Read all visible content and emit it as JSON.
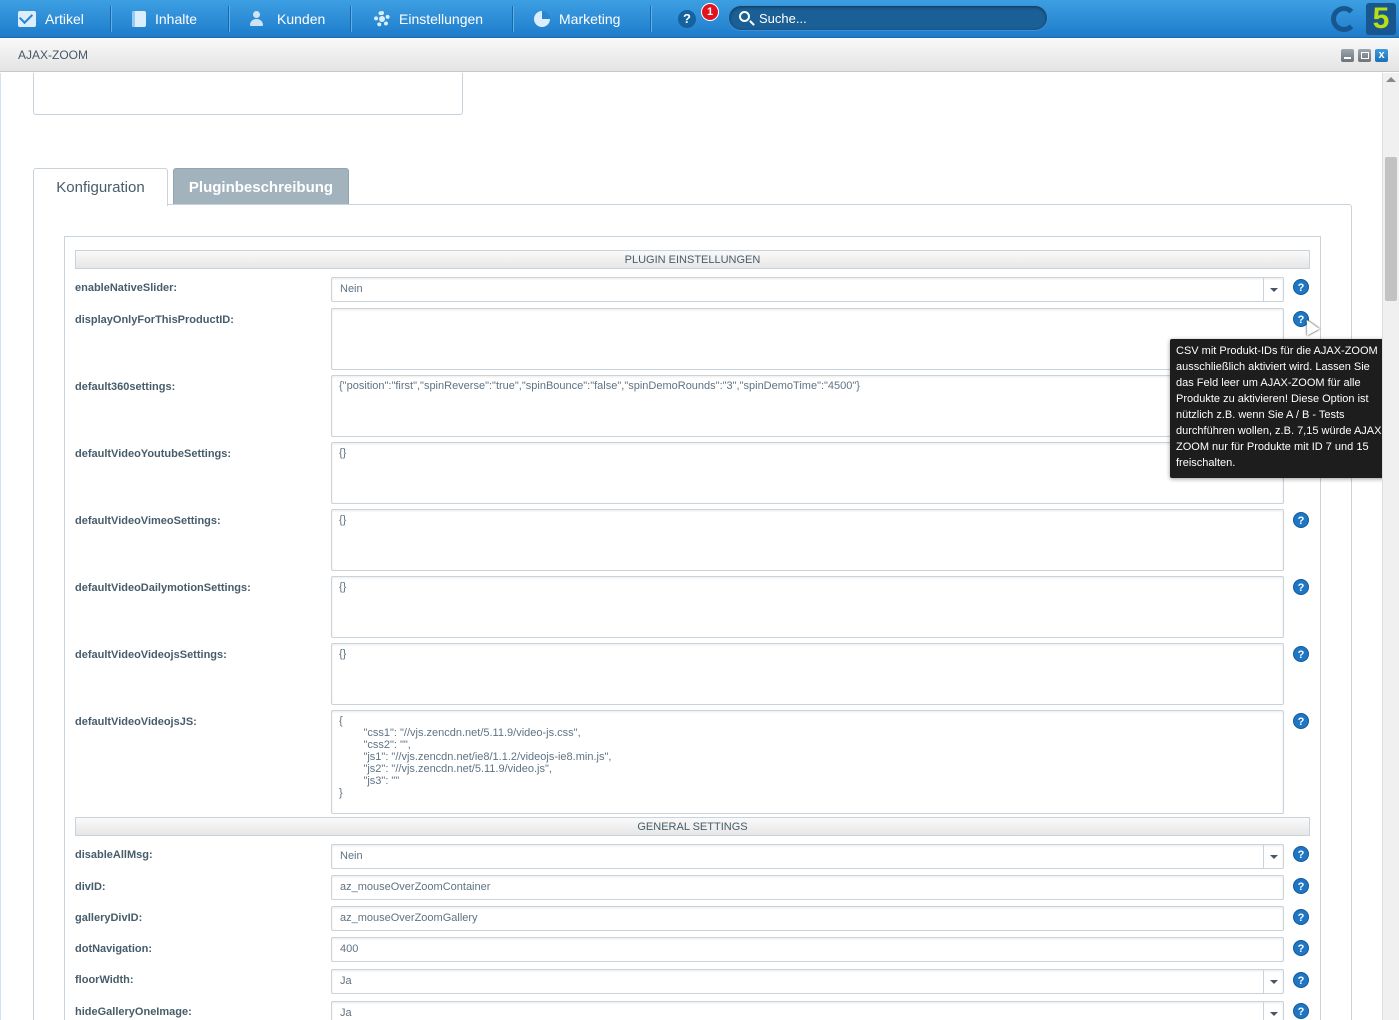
{
  "topnav": {
    "items": [
      {
        "label": "Artikel",
        "icon": "mail-icon"
      },
      {
        "label": "Inhalte",
        "icon": "book-icon"
      },
      {
        "label": "Kunden",
        "icon": "users-icon"
      },
      {
        "label": "Einstellungen",
        "icon": "gear-icon"
      },
      {
        "label": "Marketing",
        "icon": "pie-chart-icon"
      }
    ],
    "help_label": "?",
    "notification_count": "1",
    "search_placeholder": "Suche...",
    "logo_text": "5",
    "colors": {
      "bar": "#1e7ccb",
      "notification": "#e0141e",
      "logo_accent": "#b7df12"
    }
  },
  "window": {
    "title": "AJAX-ZOOM",
    "close_label": "x"
  },
  "tabs": [
    {
      "label": "Konfiguration",
      "active": true
    },
    {
      "label": "Pluginbeschreibung",
      "active": false
    }
  ],
  "sections": {
    "plugin": "PLUGIN EINSTELLUNGEN",
    "general": "GENERAL SETTINGS"
  },
  "help_icon_label": "?",
  "fields": {
    "enableNativeSlider": {
      "label": "enableNativeSlider:",
      "value": "Nein"
    },
    "displayOnlyForThisProductID": {
      "label": "displayOnlyForThisProductID:",
      "value": ""
    },
    "default360settings": {
      "label": "default360settings:",
      "value": "{\"position\":\"first\",\"spinReverse\":\"true\",\"spinBounce\":\"false\",\"spinDemoRounds\":\"3\",\"spinDemoTime\":\"4500\"}"
    },
    "defaultVideoYoutubeSettings": {
      "label": "defaultVideoYoutubeSettings:",
      "value": "{}"
    },
    "defaultVideoVimeoSettings": {
      "label": "defaultVideoVimeoSettings:",
      "value": "{}"
    },
    "defaultVideoDailymotionSettings": {
      "label": "defaultVideoDailymotionSettings:",
      "value": "{}"
    },
    "defaultVideoVideojsSettings": {
      "label": "defaultVideoVideojsSettings:",
      "value": "{}"
    },
    "defaultVideoVideojsJS": {
      "label": "defaultVideoVideojsJS:",
      "value": "{\n        \"css1\": \"//vjs.zencdn.net/5.11.9/video-js.css\",\n        \"css2\": \"\",\n        \"js1\": \"//vjs.zencdn.net/ie8/1.1.2/videojs-ie8.min.js\",\n        \"js2\": \"//vjs.zencdn.net/5.11.9/video.js\",\n        \"js3\": \"\"\n}"
    },
    "disableAllMsg": {
      "label": "disableAllMsg:",
      "value": "Nein"
    },
    "divID": {
      "label": "divID:",
      "value": "az_mouseOverZoomContainer"
    },
    "galleryDivID": {
      "label": "galleryDivID:",
      "value": "az_mouseOverZoomGallery"
    },
    "dotNavigation": {
      "label": "dotNavigation:",
      "value": "400"
    },
    "floorWidth": {
      "label": "floorWidth:",
      "value": "Ja"
    },
    "hideGalleryOneImage": {
      "label": "hideGalleryOneImage:",
      "value": "Ja"
    }
  },
  "tooltip": {
    "text": "CSV mit Produkt-IDs für die AJAX-ZOOM ausschließlich aktiviert wird. Lassen Sie das Feld leer um AJAX-ZOOM für alle Produkte zu aktivieren! Diese Option ist nützlich z.B. wenn Sie A / B - Tests durchführen wollen, z.B. 7,15 würde AJAX-ZOOM nur für Produkte mit ID 7 und 15 freischalten."
  }
}
